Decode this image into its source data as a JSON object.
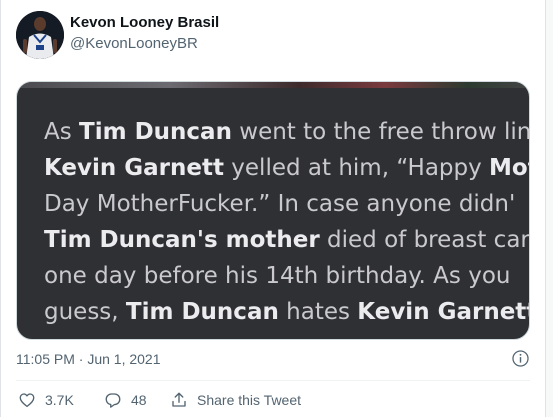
{
  "author": {
    "display_name": "Kevon Looney Brasil",
    "handle": "@KevonLooneyBR"
  },
  "media": {
    "lines": [
      [
        {
          "t": "As ",
          "b": false
        },
        {
          "t": "Tim Duncan",
          "b": true
        },
        {
          "t": " went to the free throw lin",
          "b": false
        }
      ],
      [
        {
          "t": "Kevin Garnett",
          "b": true
        },
        {
          "t": " yelled at him, “Happy ",
          "b": false
        },
        {
          "t": "Mot",
          "b": true
        }
      ],
      [
        {
          "t": "Day MotherFucker.” In case anyone didn'",
          "b": false
        }
      ],
      [
        {
          "t": "Tim Duncan's mother",
          "b": true
        },
        {
          "t": " died of breast car",
          "b": false
        }
      ],
      [
        {
          "t": "one day before his 14th birthday. As you ",
          "b": false
        }
      ],
      [
        {
          "t": "guess, ",
          "b": false
        },
        {
          "t": "Tim Duncan",
          "b": true
        },
        {
          "t": " hates ",
          "b": false
        },
        {
          "t": "Kevin Garnett",
          "b": true
        }
      ]
    ]
  },
  "meta": {
    "timestamp": "11:05 PM · Jun 1, 2021"
  },
  "actions": {
    "like_count": "3.7K",
    "reply_count": "48",
    "share_label": "Share this Tweet"
  },
  "icons": {
    "like": "heart-icon",
    "reply": "reply-icon",
    "share": "share-icon",
    "info": "info-icon"
  },
  "colors": {
    "text_primary": "#0f1419",
    "text_secondary": "#536471",
    "media_background": "#2f3034"
  }
}
